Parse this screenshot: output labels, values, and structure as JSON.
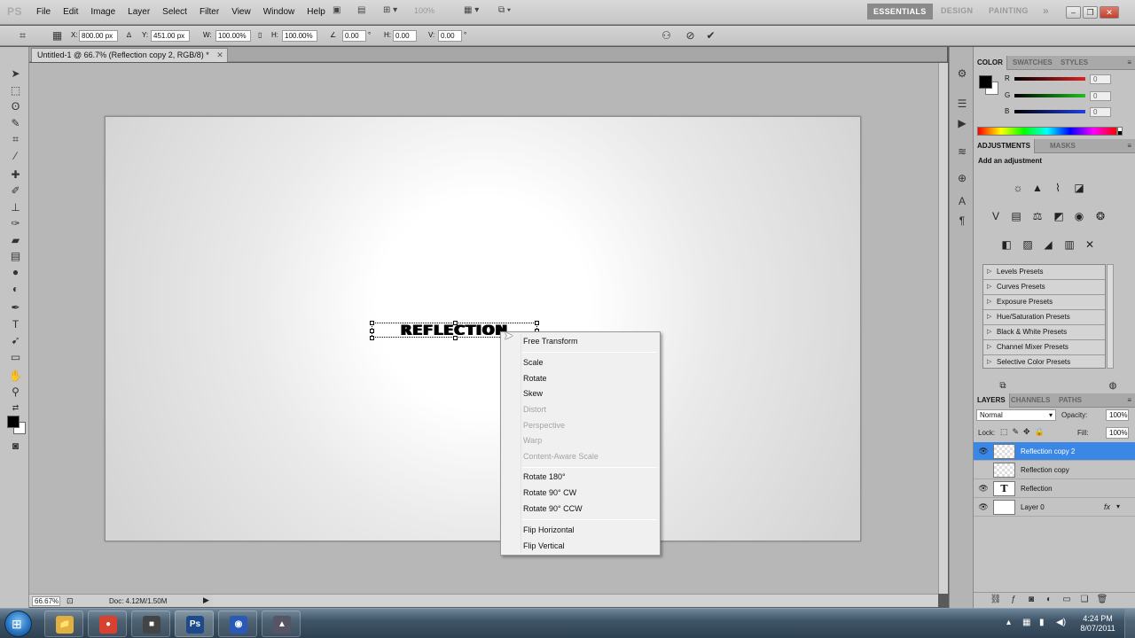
{
  "app": {
    "logo": "PS",
    "menus": [
      "File",
      "Edit",
      "Image",
      "Layer",
      "Select",
      "Filter",
      "View",
      "Window",
      "Help"
    ],
    "zoom_display": "100%",
    "workspaces": [
      "ESSENTIALS",
      "DESIGN",
      "PAINTING"
    ],
    "workspace_more": "»"
  },
  "options": {
    "x_label": "X:",
    "x_value": "800.00 px",
    "y_label": "Y:",
    "y_value": "451.00 px",
    "w_label": "W:",
    "w_value": "100.00%",
    "h_label": "H:",
    "h_value": "100.00%",
    "angle_value": "0.00",
    "angle_unit": "°",
    "hskew_label": "H:",
    "hskew_value": "0.00",
    "vskew_label": "V:",
    "vskew_value": "0.00",
    "vskew_unit": "°"
  },
  "document": {
    "tab_title": "Untitled-1 @ 66.7% (Reflection copy 2, RGB/8) *",
    "tab_close": "✕",
    "canvas_text": "REFLECTION",
    "zoom_status": "66.67%",
    "doc_size": "Doc: 4.12M/1.50M"
  },
  "context_menu": {
    "items": [
      {
        "label": "Free Transform",
        "enabled": true
      },
      {
        "label": "Scale",
        "enabled": true
      },
      {
        "label": "Rotate",
        "enabled": true
      },
      {
        "label": "Skew",
        "enabled": true
      },
      {
        "label": "Distort",
        "enabled": false
      },
      {
        "label": "Perspective",
        "enabled": false
      },
      {
        "label": "Warp",
        "enabled": false
      },
      {
        "label": "Content-Aware Scale",
        "enabled": false
      },
      {
        "label": "Rotate 180°",
        "enabled": true
      },
      {
        "label": "Rotate 90° CW",
        "enabled": true
      },
      {
        "label": "Rotate 90° CCW",
        "enabled": true
      },
      {
        "label": "Flip Horizontal",
        "enabled": true
      },
      {
        "label": "Flip Vertical",
        "enabled": true
      }
    ]
  },
  "color_panel": {
    "tabs": [
      "COLOR",
      "SWATCHES",
      "STYLES"
    ],
    "channels": [
      {
        "label": "R",
        "value": "0",
        "color": "#e02020"
      },
      {
        "label": "G",
        "value": "0",
        "color": "#20c020"
      },
      {
        "label": "B",
        "value": "0",
        "color": "#2040e0"
      }
    ]
  },
  "adjustments_panel": {
    "tabs": [
      "ADJUSTMENTS",
      "MASKS"
    ],
    "title": "Add an adjustment",
    "presets": [
      "Levels Presets",
      "Curves Presets",
      "Exposure Presets",
      "Hue/Saturation Presets",
      "Black & White Presets",
      "Channel Mixer Presets",
      "Selective Color Presets"
    ]
  },
  "layers_panel": {
    "tabs": [
      "LAYERS",
      "CHANNELS",
      "PATHS"
    ],
    "blend_mode": "Normal",
    "opacity_label": "Opacity:",
    "opacity_value": "100%",
    "lock_label": "Lock:",
    "fill_label": "Fill:",
    "fill_value": "100%",
    "layers": [
      {
        "name": "Reflection copy 2",
        "visible": true,
        "selected": true,
        "type": "transparent"
      },
      {
        "name": "Reflection copy",
        "visible": false,
        "selected": false,
        "type": "transparent"
      },
      {
        "name": "Reflection",
        "visible": true,
        "selected": false,
        "type": "text",
        "thumb_text": "T"
      },
      {
        "name": "Layer 0",
        "visible": true,
        "selected": false,
        "type": "plain",
        "fx": "fx"
      }
    ]
  },
  "taskbar": {
    "apps": [
      {
        "name": "explorer",
        "glyph": "📁",
        "color": "#e0b040"
      },
      {
        "name": "chrome",
        "glyph": "●",
        "color": "#d84030"
      },
      {
        "name": "media",
        "glyph": "■",
        "color": "#444"
      },
      {
        "name": "photoshop",
        "glyph": "Ps",
        "color": "#1c4a8a"
      },
      {
        "name": "browser",
        "glyph": "◉",
        "color": "#2a5ab8"
      },
      {
        "name": "tool",
        "glyph": "▲",
        "color": "#556"
      }
    ],
    "time": "4:24 PM",
    "date": "8/07/2011"
  }
}
